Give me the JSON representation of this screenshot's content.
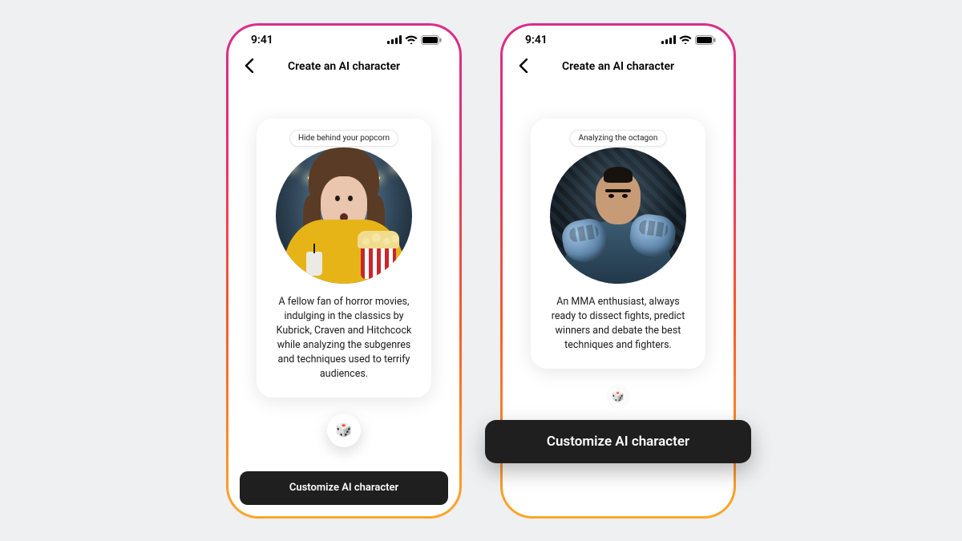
{
  "status": {
    "time": "9:41"
  },
  "nav": {
    "title": "Create an AI character",
    "back_aria": "Back"
  },
  "screens": [
    {
      "chip": "Hide behind your popcorn",
      "description": "A fellow fan of horror movies, indulging in the classics by Kubrick, Craven and Hitchcock while analyzing the subgenres and techniques used to terrify audiences.",
      "cta": "Customize AI character",
      "shuffle_aria": "Shuffle suggestion",
      "avatar_alt": "Frightened woman in a yellow jacket holding popcorn in a dark hallway"
    },
    {
      "chip": "Analyzing the octagon",
      "description": "An MMA enthusiast, always ready to dissect fights, predict winners and debate the best techniques and fighters.",
      "cta": "Customize AI character",
      "shuffle_aria": "Shuffle suggestion",
      "avatar_alt": "MMA fighter with raised gloves inside a cage"
    }
  ]
}
